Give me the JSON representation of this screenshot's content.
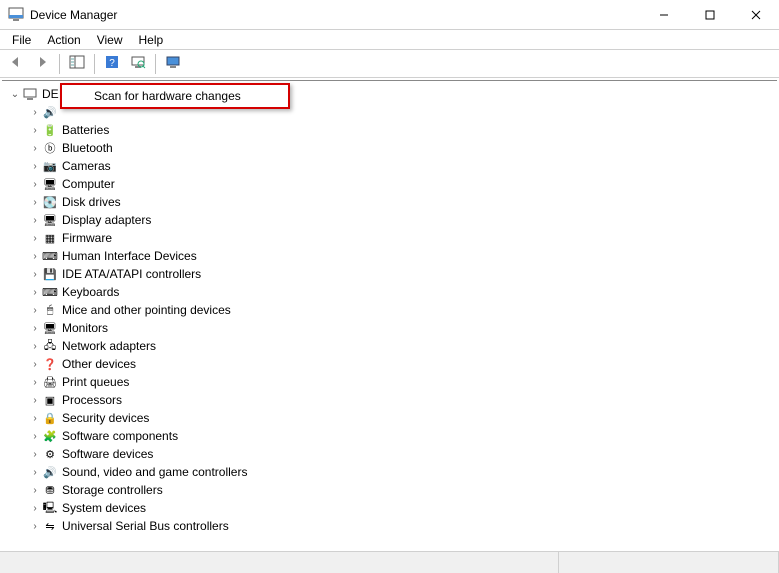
{
  "window": {
    "title": "Device Manager"
  },
  "menus": [
    "File",
    "Action",
    "View",
    "Help"
  ],
  "root": {
    "label": "DE"
  },
  "context_menu": {
    "items": [
      "Scan for hardware changes"
    ]
  },
  "categories": [
    {
      "label": "",
      "icon": "audio"
    },
    {
      "label": "Batteries",
      "icon": "battery"
    },
    {
      "label": "Bluetooth",
      "icon": "bluetooth"
    },
    {
      "label": "Cameras",
      "icon": "camera"
    },
    {
      "label": "Computer",
      "icon": "computer"
    },
    {
      "label": "Disk drives",
      "icon": "disk"
    },
    {
      "label": "Display adapters",
      "icon": "display"
    },
    {
      "label": "Firmware",
      "icon": "firmware"
    },
    {
      "label": "Human Interface Devices",
      "icon": "hid"
    },
    {
      "label": "IDE ATA/ATAPI controllers",
      "icon": "ide"
    },
    {
      "label": "Keyboards",
      "icon": "keyboard"
    },
    {
      "label": "Mice and other pointing devices",
      "icon": "mouse"
    },
    {
      "label": "Monitors",
      "icon": "monitor"
    },
    {
      "label": "Network adapters",
      "icon": "network"
    },
    {
      "label": "Other devices",
      "icon": "other"
    },
    {
      "label": "Print queues",
      "icon": "printer"
    },
    {
      "label": "Processors",
      "icon": "cpu"
    },
    {
      "label": "Security devices",
      "icon": "security"
    },
    {
      "label": "Software components",
      "icon": "swcomp"
    },
    {
      "label": "Software devices",
      "icon": "swdev"
    },
    {
      "label": "Sound, video and game controllers",
      "icon": "sound"
    },
    {
      "label": "Storage controllers",
      "icon": "storage"
    },
    {
      "label": "System devices",
      "icon": "system"
    },
    {
      "label": "Universal Serial Bus controllers",
      "icon": "usb"
    }
  ],
  "icons": {
    "audio": "🔊",
    "battery": "🔋",
    "bluetooth": "ⓑ",
    "camera": "📷",
    "computer": "🖥",
    "disk": "💽",
    "display": "🖥",
    "firmware": "▦",
    "hid": "⌨",
    "ide": "💾",
    "keyboard": "⌨",
    "mouse": "🖱",
    "monitor": "🖥",
    "network": "🖧",
    "other": "❓",
    "printer": "🖨",
    "cpu": "▣",
    "security": "🔒",
    "swcomp": "🧩",
    "swdev": "⚙",
    "sound": "🔊",
    "storage": "⛃",
    "system": "🖳",
    "usb": "⇋"
  }
}
